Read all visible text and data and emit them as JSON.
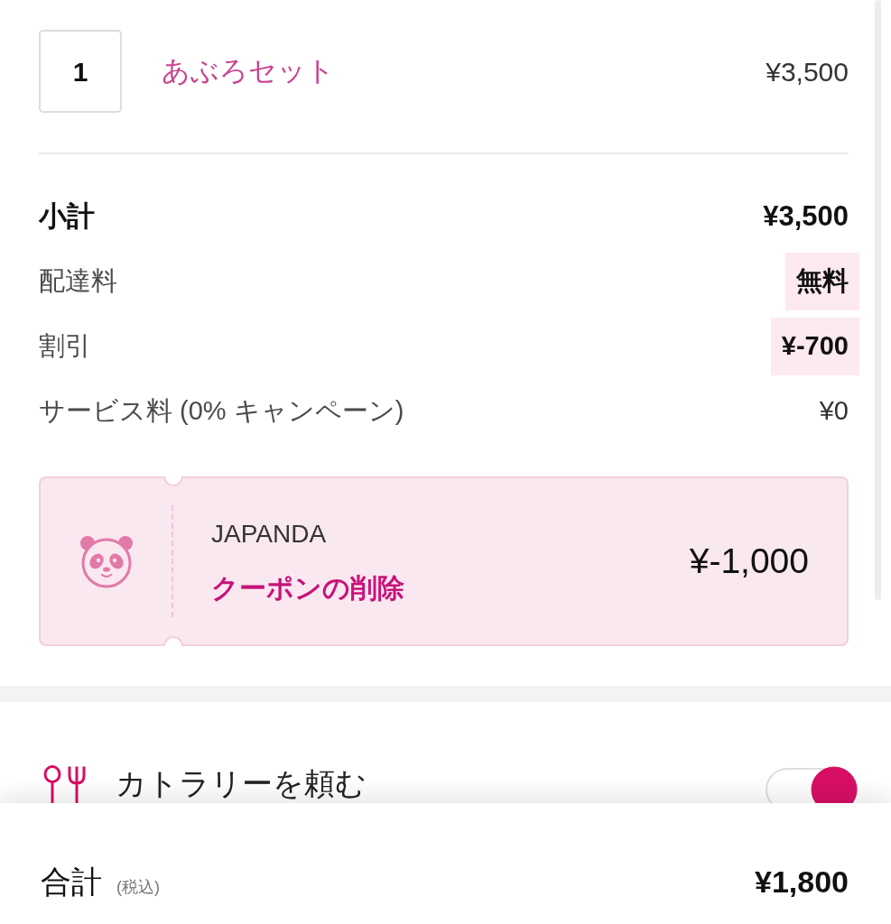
{
  "order_items": [
    {
      "quantity": "1",
      "name": "あぶろセット",
      "price": "¥3,500"
    }
  ],
  "summary": [
    {
      "kind": "subtotal",
      "label": "小計",
      "value": "¥3,500"
    },
    {
      "kind": "highlighted",
      "label": "配達料",
      "value": "無料"
    },
    {
      "kind": "highlighted",
      "label": "割引",
      "value": "¥-700"
    },
    {
      "kind": "plain",
      "label": "サービス料 (0% キャンペーン)",
      "value": "¥0"
    }
  ],
  "coupon": {
    "code": "JAPANDA",
    "remove_link": "クーポンの削除",
    "amount": "¥-1,000"
  },
  "cutlery": {
    "label": "カトラリーを頼む",
    "on": true
  },
  "total": {
    "label": "合計",
    "note": "(税込)",
    "value": "¥1,800"
  }
}
